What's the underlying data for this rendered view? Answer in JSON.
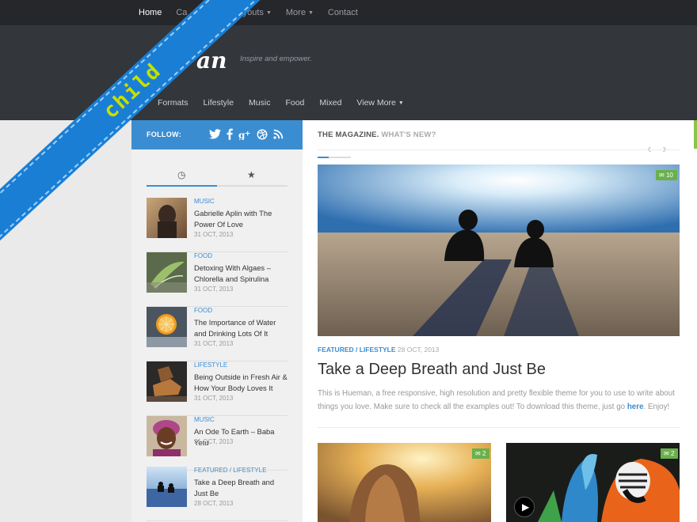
{
  "topnav": {
    "items": [
      {
        "label": "Home"
      },
      {
        "label": "Ca"
      },
      {
        "label": ""
      },
      {
        "label": "Layouts"
      },
      {
        "label": "More"
      },
      {
        "label": "Contact"
      }
    ]
  },
  "header": {
    "logo_text": "an",
    "tagline": "Inspire and empower."
  },
  "catnav": {
    "items": [
      {
        "label": "Formats"
      },
      {
        "label": "Lifestyle"
      },
      {
        "label": "Music"
      },
      {
        "label": "Food"
      },
      {
        "label": "Mixed"
      },
      {
        "label": "View More"
      }
    ]
  },
  "ribbon": {
    "label": "child"
  },
  "sidebar": {
    "follow_label": "FOLLOW:",
    "social_icons": [
      "twitter-icon",
      "facebook-icon",
      "google-plus-icon",
      "dribbble-icon",
      "rss-icon"
    ],
    "tab_icons": [
      "clock-icon",
      "star-icon"
    ],
    "posts": [
      {
        "category": "MUSIC",
        "title": "Gabrielle Aplin with The Power Of Love",
        "date": "31 OCT, 2013"
      },
      {
        "category": "FOOD",
        "title": "Detoxing With Algaes – Chlorella and Spirulina",
        "date": "31 OCT, 2013"
      },
      {
        "category": "FOOD",
        "title": "The Importance of Water and Drinking Lots Of It",
        "date": "31 OCT, 2013"
      },
      {
        "category": "LIFESTYLE",
        "title": "Being Outside in Fresh Air & How Your Body Loves It",
        "date": "31 OCT, 2013"
      },
      {
        "category": "MUSIC",
        "title": "An Ode To Earth – Baba Yetu",
        "date": "31 OCT, 2013"
      },
      {
        "category": "FEATURED / LIFESTYLE",
        "title": "Take a Deep Breath and Just Be",
        "date": "28 OCT, 2013"
      }
    ]
  },
  "main": {
    "heading": "THE MAGAZINE.",
    "subheading": "WHAT'S NEW?",
    "featured": {
      "comments": "10",
      "category": "FEATURED / LIFESTYLE",
      "date": "28 OCT, 2013",
      "title": "Take a Deep Breath and Just Be",
      "excerpt_before": "This is Hueman, a free responsive, high resolution and pretty flexible theme for you to use to write about things you love. Make sure to check all the examples out! To download this theme, just go ",
      "excerpt_link": "here",
      "excerpt_after": ". Enjoy!"
    },
    "cards": [
      {
        "comments": "2"
      },
      {
        "comments": "2"
      }
    ]
  },
  "colors": {
    "accent": "#3b8dd1",
    "badge": "#6ab04c",
    "ribbon": "#1a7fd4",
    "ribbon_text": "#c6e000"
  }
}
